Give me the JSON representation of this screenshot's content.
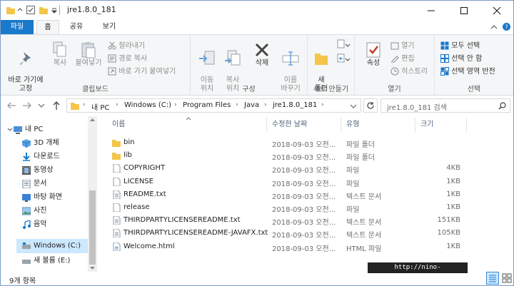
{
  "window": {
    "title": "jre1.8.0_181"
  },
  "menu": {
    "file": "파일",
    "home": "홈",
    "share": "공유",
    "view": "보기"
  },
  "ribbon": {
    "pin": "바로 가기에\n고정",
    "copy": "복사",
    "paste": "붙여넣기",
    "cut": "잘라내기",
    "copy_path": "경로 복사",
    "paste_shortcut": "바로 가기 붙여넣기",
    "clipboard_group": "클립보드",
    "move_to": "이동\n위치 ",
    "copy_to": "복사\n위치 ",
    "delete": "삭제",
    "rename": "이름\n바꾸기",
    "organize_group": "구성",
    "new_folder": "새\n폴더",
    "new_group": "새로 만들기",
    "properties": "속성",
    "open": "열기",
    "edit": "편집",
    "history": "히스토리",
    "open_group": "열기",
    "select_all": "모두 선택",
    "select_none": "선택 안 함",
    "invert_selection": "선택 영역 반전",
    "select_group": "선택"
  },
  "address": {
    "crumbs": [
      "내 PC",
      "Windows (C:)",
      "Program Files",
      "Java",
      "jre1.8.0_181"
    ],
    "search_placeholder": "jre1.8.0_181 검색"
  },
  "navpane": {
    "items": [
      {
        "label": "내 PC",
        "icon": "pc-icon"
      },
      {
        "label": "3D 개체",
        "icon": "3d-objects-icon"
      },
      {
        "label": "다운로드",
        "icon": "download-icon"
      },
      {
        "label": "동영상",
        "icon": "video-icon"
      },
      {
        "label": "문서",
        "icon": "document-icon"
      },
      {
        "label": "바탕 화면",
        "icon": "desktop-icon"
      },
      {
        "label": "사진",
        "icon": "pictures-icon"
      },
      {
        "label": "음악",
        "icon": "music-icon"
      },
      {
        "label": "Windows (C:)",
        "icon": "drive-icon"
      },
      {
        "label": "새 볼륨 (E:)",
        "icon": "drive-icon"
      }
    ]
  },
  "filelist": {
    "columns": {
      "name": "이름",
      "date": "수정한 날짜",
      "type": "유형",
      "size": "크기"
    },
    "rows": [
      {
        "name": "bin",
        "date": "2018-09-03 오전...",
        "type": "파일 폴더",
        "size": "",
        "icon": "folder"
      },
      {
        "name": "lib",
        "date": "2018-09-03 오전...",
        "type": "파일 폴더",
        "size": "",
        "icon": "folder"
      },
      {
        "name": "COPYRIGHT",
        "date": "2018-09-03 오전...",
        "type": "파일",
        "size": "4KB",
        "icon": "file"
      },
      {
        "name": "LICENSE",
        "date": "2018-09-03 오전...",
        "type": "파일",
        "size": "1KB",
        "icon": "file"
      },
      {
        "name": "README.txt",
        "date": "2018-09-03 오전...",
        "type": "텍스트 문서",
        "size": "1KB",
        "icon": "text"
      },
      {
        "name": "release",
        "date": "2018-09-03 오전...",
        "type": "파일",
        "size": "1KB",
        "icon": "file"
      },
      {
        "name": "THIRDPARTYLICENSEREADME.txt",
        "date": "2018-09-03 오전...",
        "type": "텍스트 문서",
        "size": "151KB",
        "icon": "text"
      },
      {
        "name": "THIRDPARTYLICENSEREADME-JAVAFX.txt",
        "date": "2018-09-03 오전...",
        "type": "텍스트 문서",
        "size": "105KB",
        "icon": "text"
      },
      {
        "name": "Welcome.html",
        "date": "2018-09-03 오전...",
        "type": "HTML 파일",
        "size": "1KB",
        "icon": "html"
      }
    ]
  },
  "status": {
    "count": "9개 항목",
    "watermark": "http://nino-life.tistory.com"
  },
  "colors": {
    "accent": "#1979ca",
    "folder": "#f3c649",
    "selected": "#cce8ff"
  }
}
